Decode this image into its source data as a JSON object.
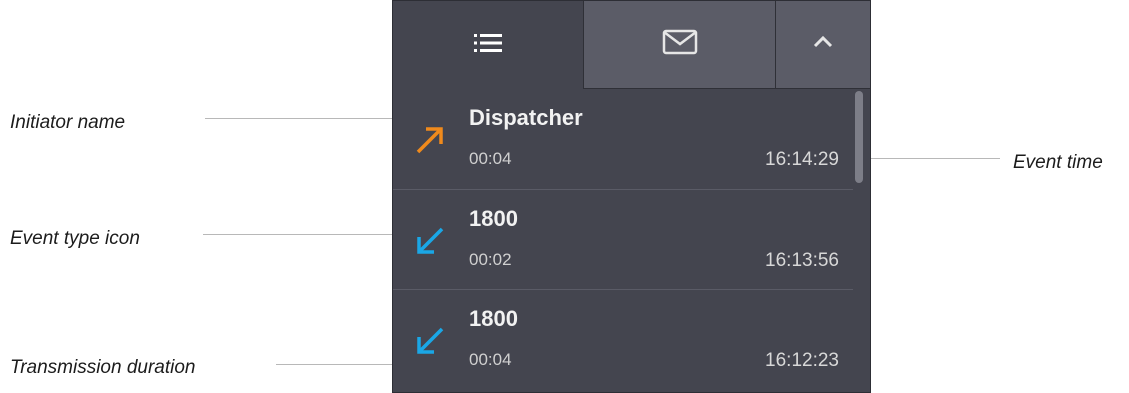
{
  "callouts": {
    "initiator_name": "Initiator name",
    "event_type_icon": "Event type icon",
    "transmission_duration": "Transmission duration",
    "event_time": "Event time"
  },
  "tabs": [
    {
      "icon": "list-icon",
      "active": true
    },
    {
      "icon": "mail-icon",
      "active": false
    },
    {
      "icon": "chevron-up-icon",
      "active": false
    }
  ],
  "events": [
    {
      "name": "Dispatcher",
      "duration": "00:04",
      "time": "16:14:29",
      "direction": "outgoing",
      "icon": "arrow-up-right-icon",
      "color": "#f08a1c"
    },
    {
      "name": "1800",
      "duration": "00:02",
      "time": "16:13:56",
      "direction": "incoming",
      "icon": "arrow-down-left-icon",
      "color": "#1aa7e6"
    },
    {
      "name": "1800",
      "duration": "00:04",
      "time": "16:12:23",
      "direction": "incoming",
      "icon": "arrow-down-left-icon",
      "color": "#1aa7e6"
    }
  ],
  "colors": {
    "panel_bg": "#44454f",
    "tab_inactive_bg": "#5b5c67",
    "outgoing": "#f08a1c",
    "incoming": "#1aa7e6"
  }
}
